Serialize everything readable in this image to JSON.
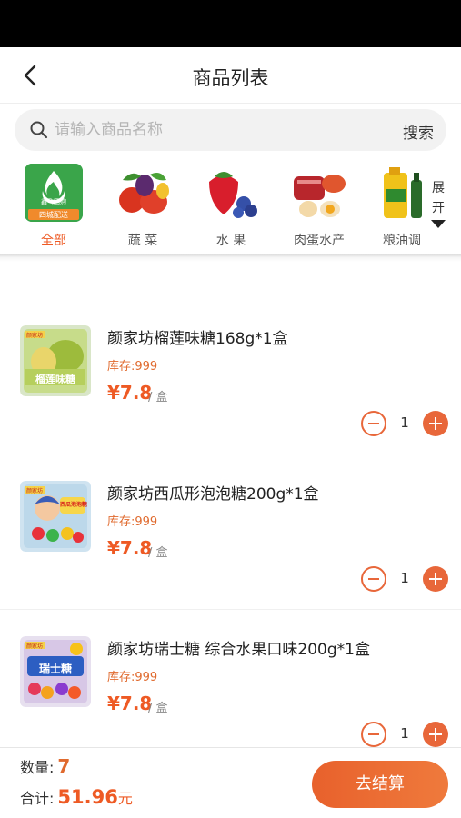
{
  "header": {
    "title": "商品列表"
  },
  "search": {
    "placeholder": "请输入商品名称",
    "button_label": "搜索"
  },
  "categories": [
    {
      "label": "全部",
      "active": true
    },
    {
      "label": "蔬 菜",
      "active": false
    },
    {
      "label": "水 果",
      "active": false
    },
    {
      "label": "肉蛋水产",
      "active": false
    },
    {
      "label": "粮油调",
      "active": false
    }
  ],
  "logo": {
    "line1": "鑫飞团购",
    "line2": "四城配送"
  },
  "expand": {
    "line1": "展",
    "line2": "开"
  },
  "products": [
    {
      "name": "颜家坊榴莲味糖168g*1盒",
      "stock": "库存:999",
      "price": "¥7.8",
      "unit": "/ 盒",
      "qty": "1",
      "pack_text": "榴莲味糖",
      "brand_tag": "颜家坊"
    },
    {
      "name": "颜家坊西瓜形泡泡糖200g*1盒",
      "stock": "库存:999",
      "price": "¥7.8",
      "unit": "/ 盒",
      "qty": "1",
      "pack_text": "西瓜泡泡糖",
      "brand_tag": "颜家坊"
    },
    {
      "name": "颜家坊瑞士糖 综合水果口味200g*1盒",
      "stock": "库存:999",
      "price": "¥7.8",
      "unit": "/ 盒",
      "qty": "1",
      "pack_text": "瑞士糖",
      "brand_tag": "颜家坊"
    }
  ],
  "footer": {
    "qty_label": "数量:",
    "qty_value": "7",
    "total_label": "合计:",
    "total_value": "51.96",
    "currency": "元",
    "checkout_label": "去结算"
  },
  "colors": {
    "accent": "#ee5a24",
    "accent_light": "#ef7a3c",
    "logo_green": "#3aa54a"
  },
  "icons": {
    "back": "chevron-left-icon",
    "search": "search-icon",
    "expand": "triangle-down-icon"
  }
}
